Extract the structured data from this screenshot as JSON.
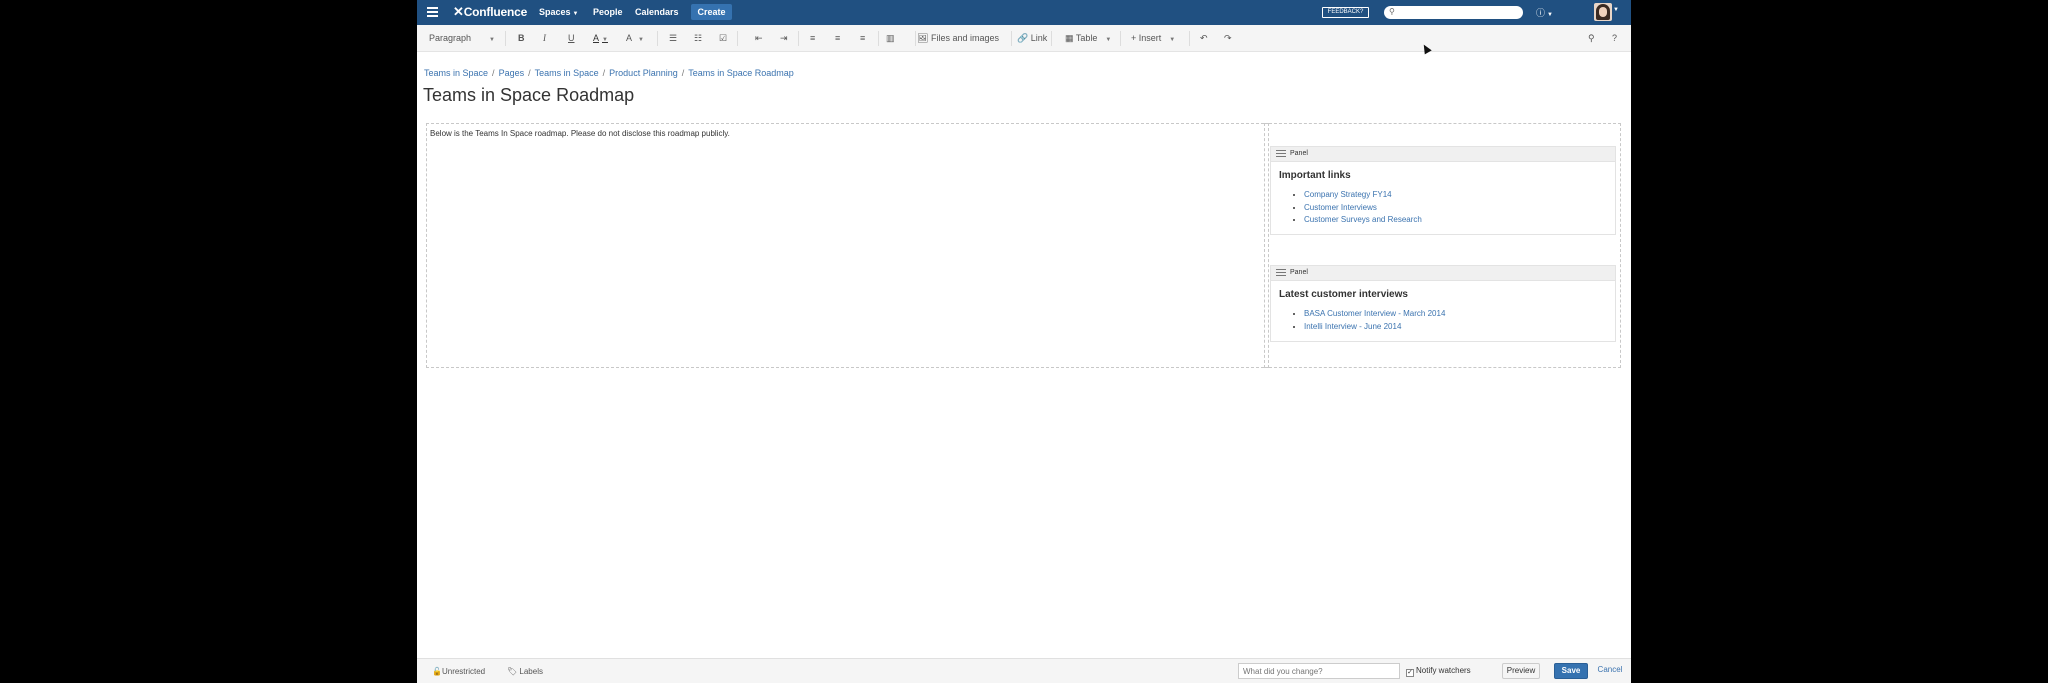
{
  "nav": {
    "logo": "Confluence",
    "spaces": "Spaces",
    "people": "People",
    "calendars": "Calendars",
    "create": "Create",
    "feedback": "FEEDBACK?",
    "search_placeholder": ""
  },
  "toolbar": {
    "paragraph": "Paragraph",
    "bold": "B",
    "italic": "I",
    "underline": "U",
    "text_color": "A",
    "format_more": "A",
    "files_images": "Files and images",
    "link": "Link",
    "table": "Table",
    "insert": "Insert",
    "help": "?"
  },
  "breadcrumb": [
    "Teams in Space",
    "Pages",
    "Teams in Space",
    "Product Planning",
    "Teams in Space Roadmap"
  ],
  "page": {
    "title": "Teams in Space Roadmap",
    "intro": "Below is the Teams In Space roadmap. Please do not disclose this roadmap publicly."
  },
  "panels": [
    {
      "label": "Panel",
      "heading": "Important links",
      "links": [
        "Company Strategy FY14",
        "Customer Interviews",
        "Customer Surveys and Research"
      ]
    },
    {
      "label": "Panel",
      "heading": "Latest customer interviews",
      "links": [
        "BASA Customer Interview - March 2014",
        "Intelli Interview - June 2014"
      ]
    }
  ],
  "footer": {
    "unrestricted": "Unrestricted",
    "labels": "Labels",
    "change_placeholder": "What did you change?",
    "notify": "Notify watchers",
    "preview": "Preview",
    "save": "Save",
    "cancel": "Cancel"
  },
  "colors": {
    "nav_bg": "#205081",
    "accent": "#3572b0",
    "link": "#3b73af"
  }
}
